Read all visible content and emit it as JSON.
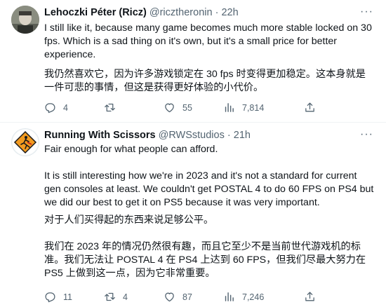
{
  "tweet1": {
    "name": "Lehoczki Péter (Ricz)",
    "handle": "@ricztheronin",
    "separator": "·",
    "time": "22h",
    "more": "···",
    "text_en": "I still like it, because many game becomes much more stable locked on 30 fps. Which is a sad thing on it's own, but it's a small price for better experience.",
    "text_zh": "我仍然喜欢它，因为许多游戏锁定在 30 fps 时变得更加稳定。这本身就是一件可悲的事情，但这是获得更好体验的小代价。",
    "replies": "4",
    "retweets": "",
    "likes": "55",
    "views": "7,814"
  },
  "tweet2": {
    "name": "Running With Scissors",
    "handle": "@RWSstudios",
    "separator": "·",
    "time": "21h",
    "more": "···",
    "p1": "Fair enough for what people can afford.",
    "p2": "It is still interesting how we're in 2023 and it's not a standard for current gen consoles at least. We couldn't get POSTAL 4 to do 60 FPS on PS4 but we did our best to get it on PS5 because it was very important.",
    "p3": "对于人们买得起的东西来说足够公平。",
    "p4": "我们在 2023 年的情况仍然很有趣，而且它至少不是当前世代游戏机的标准。我们无法让 POSTAL 4 在 PS4 上达到 60 FPS，但我们尽最大努力在 PS5 上做到这一点，因为它非常重要。",
    "replies": "11",
    "retweets": "4",
    "likes": "87",
    "views": "7,246"
  },
  "icons": {
    "reply": "reply-icon",
    "retweet": "retweet-icon",
    "like": "heart-icon",
    "views": "views-icon",
    "share": "share-icon"
  },
  "colors": {
    "text": "#0f1419",
    "secondary": "#536471",
    "divider": "#eff3f4",
    "logo_orange": "#f29a1f"
  }
}
